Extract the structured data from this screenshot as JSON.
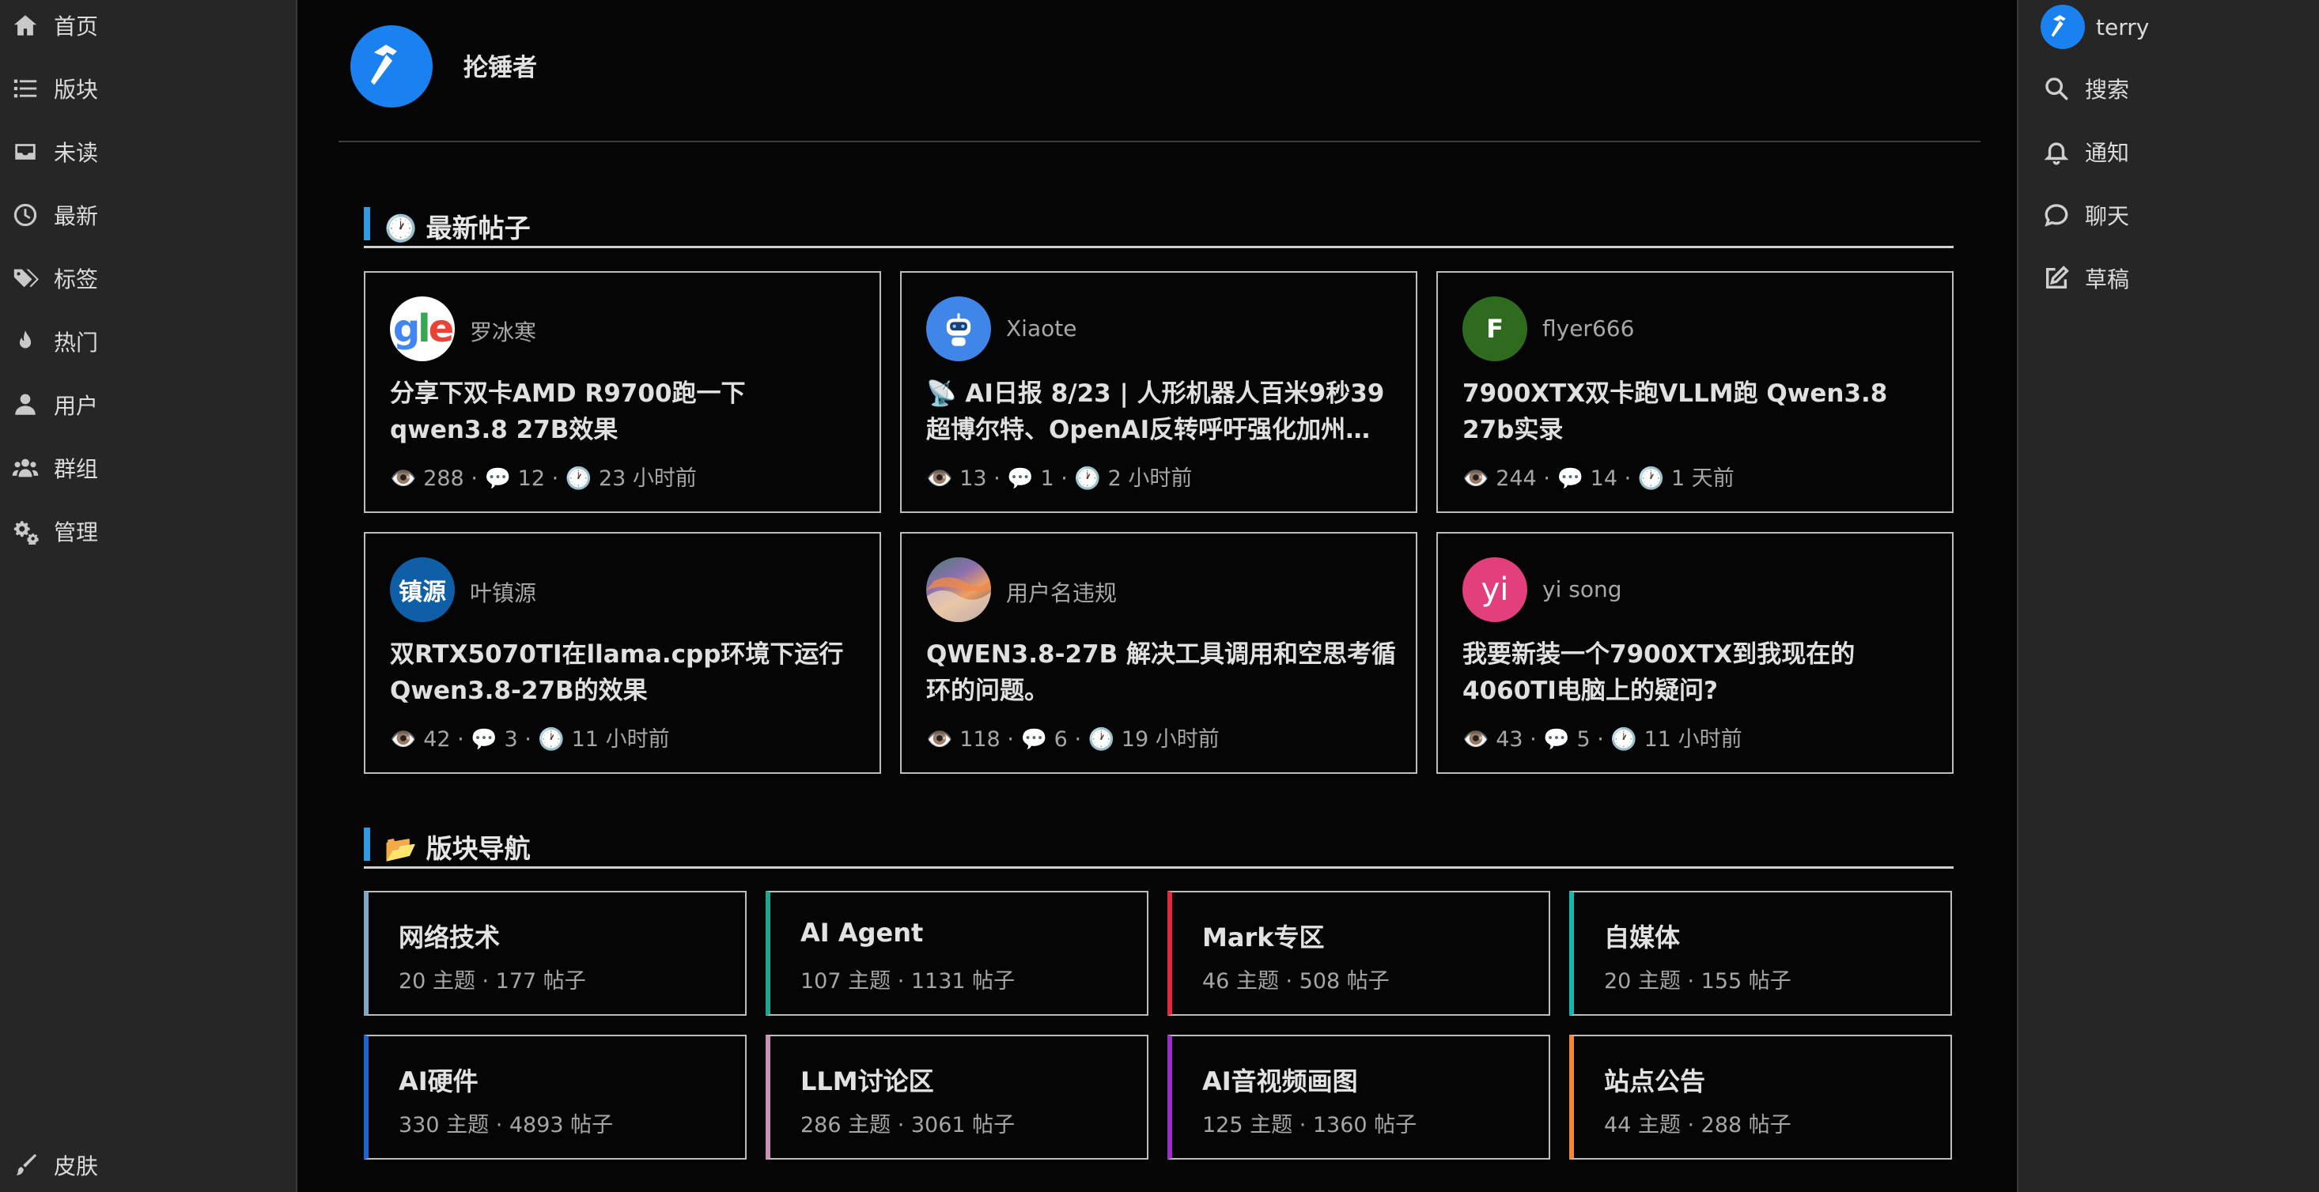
{
  "left_nav": {
    "items": [
      {
        "label": "首页",
        "icon": "home-icon"
      },
      {
        "label": "版块",
        "icon": "list-icon"
      },
      {
        "label": "未读",
        "icon": "inbox-icon"
      },
      {
        "label": "最新",
        "icon": "clock-icon"
      },
      {
        "label": "标签",
        "icon": "tags-icon"
      },
      {
        "label": "热门",
        "icon": "fire-icon"
      },
      {
        "label": "用户",
        "icon": "user-icon"
      },
      {
        "label": "群组",
        "icon": "users-icon"
      },
      {
        "label": "管理",
        "icon": "gears-icon"
      }
    ],
    "skin_label": "皮肤"
  },
  "header": {
    "site_title": "抡锤者"
  },
  "latest_posts": {
    "heading": "🕐 最新帖子",
    "posts": [
      {
        "author": "罗冰寒",
        "avatar_text": "gle",
        "avatar_color": "#ffffff",
        "title": "分享下双卡AMD R9700跑一下qwen3.8 27B效果",
        "meta": "👁️ 288 · 💬 12 · 🕐 23 小时前"
      },
      {
        "author": "Xiaote",
        "avatar_text": "",
        "avatar_color": "#3f86e8",
        "title": "📡 AI日报 8/23 | 人形机器人百米9秒39超博尔特、OpenAI反转呼吁强化加州…",
        "meta": "👁️ 13 · 💬 1 · 🕐 2 小时前"
      },
      {
        "author": "flyer666",
        "avatar_text": "F",
        "avatar_color": "#2e6b1f",
        "title": "7900XTX双卡跑VLLM跑 Qwen3.8 27b实录",
        "meta": "👁️ 244 · 💬 14 · 🕐 1 天前"
      },
      {
        "author": "叶镇源",
        "avatar_text": "镇源",
        "avatar_color": "#0f5fa8",
        "title": "双RTX5070TI在llama.cpp环境下运行Qwen3.8-27B的效果",
        "meta": "👁️ 42 · 💬 3 · 🕐 11 小时前"
      },
      {
        "author": "用户名违规",
        "avatar_text": "",
        "avatar_color": "#6b5a8e",
        "title": "QWEN3.8-27B 解决工具调用和空思考循环的问题。",
        "meta": "👁️ 118 · 💬 6 · 🕐 19 小时前"
      },
      {
        "author": "yi song",
        "avatar_text": "yi",
        "avatar_color": "#e23f7c",
        "title": "我要新装一个7900XTX到我现在的4060TI电脑上的疑问?",
        "meta": "👁️ 43 · 💬 5 · 🕐 11 小时前"
      }
    ]
  },
  "categories": {
    "heading": "📂 版块导航",
    "items": [
      {
        "name": "网络技术",
        "stats": "20 主题 · 177 帖子",
        "color": "#7fa7c4"
      },
      {
        "name": "AI Agent",
        "stats": "107 主题 · 1131 帖子",
        "color": "#1fa58b"
      },
      {
        "name": "Mark专区",
        "stats": "46 主题 · 508 帖子",
        "color": "#e02a3c"
      },
      {
        "name": "自媒体",
        "stats": "20 主题 · 155 帖子",
        "color": "#18b6b0"
      },
      {
        "name": "AI硬件",
        "stats": "330 主题 · 4893 帖子",
        "color": "#1f63d0"
      },
      {
        "name": "LLM讨论区",
        "stats": "286 主题 · 3061 帖子",
        "color": "#c98fb6"
      },
      {
        "name": "AI音视频画图",
        "stats": "125 主题 · 1360 帖子",
        "color": "#9a2fc7"
      },
      {
        "name": "站点公告",
        "stats": "44 主题 · 288 帖子",
        "color": "#f08a3a"
      }
    ]
  },
  "right_nav": {
    "username": "terry",
    "items": [
      {
        "label": "搜索",
        "icon": "search-icon"
      },
      {
        "label": "通知",
        "icon": "bell-icon"
      },
      {
        "label": "聊天",
        "icon": "chat-icon"
      },
      {
        "label": "草稿",
        "icon": "edit-icon"
      }
    ]
  }
}
